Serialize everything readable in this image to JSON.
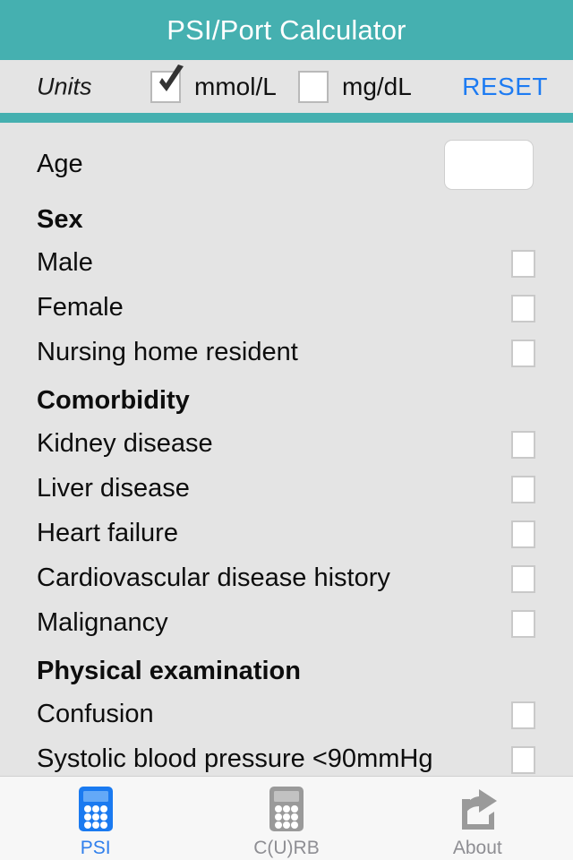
{
  "header": {
    "title": "PSI/Port Calculator",
    "background_color": "#45b0b0",
    "text_color": "#ffffff"
  },
  "units_bar": {
    "label": "Units",
    "options": [
      {
        "label": "mmol/L",
        "checked": true,
        "icon": "checkmark-icon"
      },
      {
        "label": "mg/dL",
        "checked": false,
        "icon": "empty-checkbox-icon"
      }
    ],
    "reset_label": "RESET",
    "reset_color": "#1d7bf2"
  },
  "form": {
    "rows": [
      {
        "type": "input",
        "label": "Age",
        "value": "",
        "placeholder": ""
      },
      {
        "type": "heading",
        "label": "Sex"
      },
      {
        "type": "checkbox",
        "label": "Male",
        "checked": false
      },
      {
        "type": "checkbox",
        "label": "Female",
        "checked": false
      },
      {
        "type": "checkbox",
        "label": "Nursing home resident",
        "checked": false
      },
      {
        "type": "heading",
        "label": "Comorbidity"
      },
      {
        "type": "checkbox",
        "label": "Kidney disease",
        "checked": false
      },
      {
        "type": "checkbox",
        "label": "Liver disease",
        "checked": false
      },
      {
        "type": "checkbox",
        "label": "Heart failure",
        "checked": false
      },
      {
        "type": "checkbox",
        "label": "Cardiovascular disease history",
        "checked": false
      },
      {
        "type": "checkbox",
        "label": "Malignancy",
        "checked": false
      },
      {
        "type": "heading",
        "label": "Physical examination"
      },
      {
        "type": "checkbox",
        "label": "Confusion",
        "checked": false
      },
      {
        "type": "checkbox",
        "label": "Systolic blood pressure <90mmHg",
        "checked": false
      }
    ]
  },
  "tabbar": {
    "tabs": [
      {
        "label": "PSI",
        "icon": "calculator-icon",
        "active": true,
        "color": "#2f7fec"
      },
      {
        "label": "C(U)RB",
        "icon": "calculator-icon",
        "active": false,
        "color": "#8e8e93"
      },
      {
        "label": "About",
        "icon": "share-export-icon",
        "active": false,
        "color": "#8e8e93"
      }
    ]
  }
}
